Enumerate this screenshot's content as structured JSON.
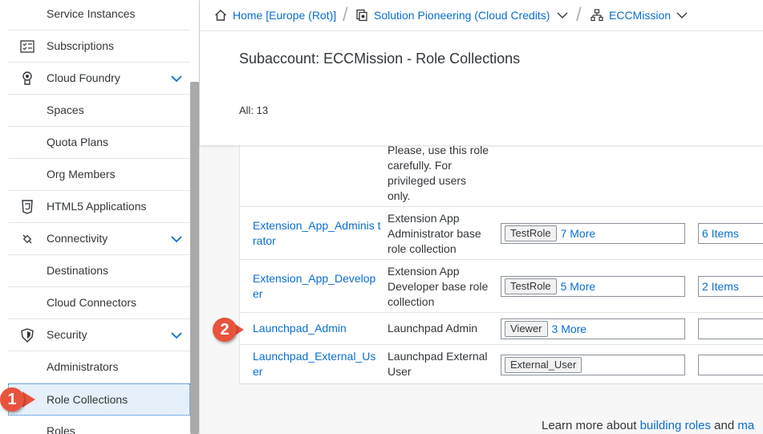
{
  "sidebar": {
    "items": [
      {
        "label": "Service Instances",
        "icon": "none",
        "expandable": false,
        "selected": false
      },
      {
        "label": "Subscriptions",
        "icon": "subscriptions-icon",
        "expandable": false,
        "selected": false
      },
      {
        "label": "Cloud Foundry",
        "icon": "cloud-foundry-icon",
        "expandable": true,
        "selected": false
      },
      {
        "label": "Spaces",
        "icon": "none",
        "expandable": false,
        "selected": false
      },
      {
        "label": "Quota Plans",
        "icon": "none",
        "expandable": false,
        "selected": false
      },
      {
        "label": "Org Members",
        "icon": "none",
        "expandable": false,
        "selected": false
      },
      {
        "label": "HTML5 Applications",
        "icon": "html5-icon",
        "expandable": false,
        "selected": false
      },
      {
        "label": "Connectivity",
        "icon": "connectivity-icon",
        "expandable": true,
        "selected": false
      },
      {
        "label": "Destinations",
        "icon": "none",
        "expandable": false,
        "selected": false
      },
      {
        "label": "Cloud Connectors",
        "icon": "none",
        "expandable": false,
        "selected": false
      },
      {
        "label": "Security",
        "icon": "shield-icon",
        "expandable": true,
        "selected": false
      },
      {
        "label": "Administrators",
        "icon": "none",
        "expandable": false,
        "selected": false
      },
      {
        "label": "Role Collections",
        "icon": "none",
        "expandable": false,
        "selected": true
      },
      {
        "label": "Roles",
        "icon": "none",
        "expandable": false,
        "selected": false
      }
    ]
  },
  "breadcrumb": {
    "home": "Home [Europe (Rot)]",
    "global_account": "Solution Pioneering (Cloud Credits)",
    "subaccount": "ECCMission"
  },
  "header": {
    "title": "Subaccount: ECCMission - Role Collections",
    "count": "All: 13"
  },
  "table": {
    "partial_row": {
      "description": "Please, use this role carefully. For privileged users only."
    },
    "rows": [
      {
        "name": "Extension_App_Adminis trator",
        "description": "Extension App Administrator base role collection",
        "role_token": "TestRole",
        "role_more": "7 More",
        "users": "6 Items"
      },
      {
        "name": "Extension_App_Develop er",
        "description": "Extension App Developer base role collection",
        "role_token": "TestRole",
        "role_more": "5 More",
        "users": "2 Items"
      },
      {
        "name": "Launchpad_Admin",
        "description": "Launchpad Admin",
        "role_token": "Viewer",
        "role_more": "3 More",
        "users": ""
      },
      {
        "name": "Launchpad_External_Us er",
        "description": "Launchpad External User",
        "role_token": "External_User",
        "role_more": "",
        "users": ""
      }
    ]
  },
  "footer": {
    "text": "Learn more about ",
    "link1": "building roles",
    "text2": " and ",
    "link2": "ma"
  },
  "markers": {
    "m1": "1",
    "m2": "2"
  },
  "colors": {
    "accent": "#0a6ed1",
    "marker": "#e8533d",
    "selected_bg": "#e5f0fa"
  }
}
